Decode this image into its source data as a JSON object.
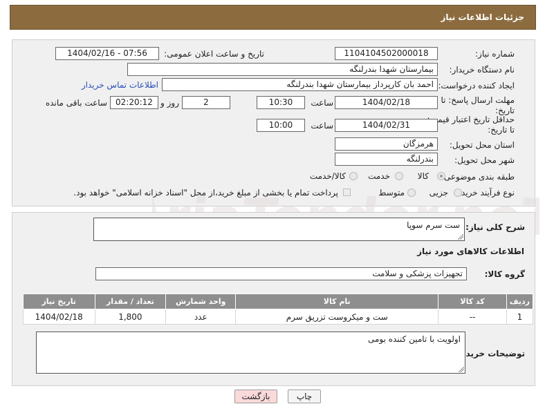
{
  "header": {
    "title": "جزئیات اطلاعات نیاز"
  },
  "form": {
    "need_number_label": "شماره نیاز:",
    "need_number": "1104104502000018",
    "announce_label": "تاریخ و ساعت اعلان عمومی:",
    "announce_value": "1404/02/16 - 07:56",
    "buyer_org_label": "نام دستگاه خریدار:",
    "buyer_org": "بیمارستان شهدا بندرلنگه",
    "creator_label": "ایجاد کننده درخواست:",
    "creator": "احمد بان کارپرداز بیمارستان شهدا بندرلنگه",
    "contact_link": "اطلاعات تماس خریدار",
    "deadline_label_1": "مهلت ارسال پاسخ: تا",
    "deadline_label_2": "تاریخ:",
    "deadline_date": "1404/02/18",
    "time_label": "ساعت",
    "deadline_time": "10:30",
    "days_value": "2",
    "days_label": "روز و",
    "remaining_time": "02:20:12",
    "remaining_label": "ساعت باقی مانده",
    "validity_label_1": "حداقل تاریخ اعتبار قیمت:",
    "validity_label_2": "تا تاریخ:",
    "validity_date": "1404/02/31",
    "validity_time": "10:00",
    "province_label": "استان محل تحویل:",
    "province": "هرمزگان",
    "city_label": "شهر محل تحویل:",
    "city": "بندرلنگه",
    "category_label": "طبقه بندی موضوعی:",
    "category_options": [
      "کالا",
      "خدمت",
      "کالا/خدمت"
    ],
    "category_selected": "کالا",
    "process_label": "نوع فرآیند خرید :",
    "process_options": [
      "جزیی",
      "متوسط"
    ],
    "process_note": "پرداخت تمام یا بخشی از مبلغ خرید،از محل \"اسناد خزانه اسلامی\" خواهد بود."
  },
  "description": {
    "label": "شرح کلی نیاز:",
    "value": "ست سرم سوپا"
  },
  "goods": {
    "section_title": "اطلاعات کالاهای مورد نیاز",
    "group_label": "گروه کالا:",
    "group_value": "تجهیزات پزشکی و سلامت",
    "columns": [
      "ردیف",
      "کد کالا",
      "نام کالا",
      "واحد شمارش",
      "تعداد / مقدار",
      "تاریخ نیاز"
    ],
    "rows": [
      [
        "1",
        "--",
        "ست و میکروست تزریق سرم",
        "عدد",
        "1,800",
        "1404/02/18"
      ]
    ]
  },
  "buyer_notes": {
    "label": "توضیحات خریدار:",
    "value": "اولویت با تامین کننده بومی"
  },
  "buttons": {
    "print": "چاپ",
    "back": "بازگشت"
  },
  "colors": {
    "title_bar": "#8c6c3f",
    "table_header": "#8e8e8e",
    "back_button": "#f9d9d9"
  }
}
